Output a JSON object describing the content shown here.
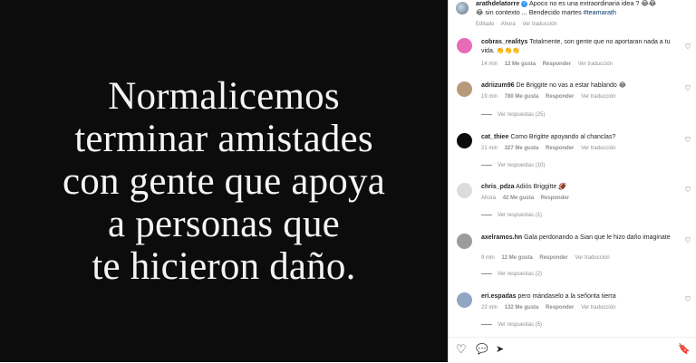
{
  "post": {
    "image_lines": [
      "Normalicemos",
      "terminar amistades",
      "con gente que apoya",
      "a personas que",
      "te hicieron daño."
    ]
  },
  "caption": {
    "username": "arathdelatorre",
    "verified_badge": "✓",
    "text_1": " Apoco no es una extraordinaria idea ? 😂😂",
    "text_2": "😂 sin contexto ... Bendecido martes ",
    "hashtag": "#teamarath",
    "edited_label": "Editado",
    "time_label": "Ahora",
    "translate_label": "Ver traducción"
  },
  "comments": [
    {
      "username": "cobras_realitys",
      "text": "Totalmente, son gente que no aportaran nada a tu vida. 👏👏👏",
      "time": "14 min",
      "likes": "12 Me gusta",
      "reply": "Responder",
      "translate": "Ver traducción",
      "replies": "",
      "avatar_color": "#e86bb8"
    },
    {
      "username": "adriizum96",
      "text": "De Briggite no vas a estar hablando 😂",
      "time": "19 min",
      "likes": "780 Me gusta",
      "reply": "Responder",
      "translate": "Ver traducción",
      "replies": "Ver respuestas (25)",
      "avatar_color": "#b79a7a"
    },
    {
      "username": "cat_thiee",
      "text": "Como Brigitte apoyando al chanclas?",
      "time": "21 min",
      "likes": "327 Me gusta",
      "reply": "Responder",
      "translate": "Ver traducción",
      "replies": "Ver respuestas (10)",
      "avatar_color": "#0b0b0b"
    },
    {
      "username": "chris_pdza",
      "text": "Adiós Briggitte 🏈",
      "time": "Ahora",
      "likes": "42 Me gusta",
      "reply": "Responder",
      "translate": "",
      "replies": "Ver respuestas (1)",
      "avatar_color": "#dcdcdc"
    },
    {
      "username": "axelramos.hn",
      "text": "Gala perdonando a Sian que le hizo daño imaginate",
      "time": "9 min",
      "likes": "12 Me gusta",
      "reply": "Responder",
      "translate": "Ver traducción",
      "replies": "Ver respuestas (2)",
      "avatar_color": "#9c9c9c"
    },
    {
      "username": "eri.espadas",
      "text": "pero mándaselo a la señorita tierra",
      "time": "23 min",
      "likes": "132 Me gusta",
      "reply": "Responder",
      "translate": "Ver traducción",
      "replies": "Ver respuestas (5)",
      "avatar_color": "#8fa7c2"
    }
  ],
  "actions": {
    "like_icon": "♡",
    "comment_icon": "💬",
    "share_icon": "➤",
    "save_icon": "🔖"
  },
  "colors": {
    "text_primary": "#262626",
    "text_secondary": "#8e8e8e",
    "media_bg": "#0c0c0c",
    "link": "#00376b"
  }
}
